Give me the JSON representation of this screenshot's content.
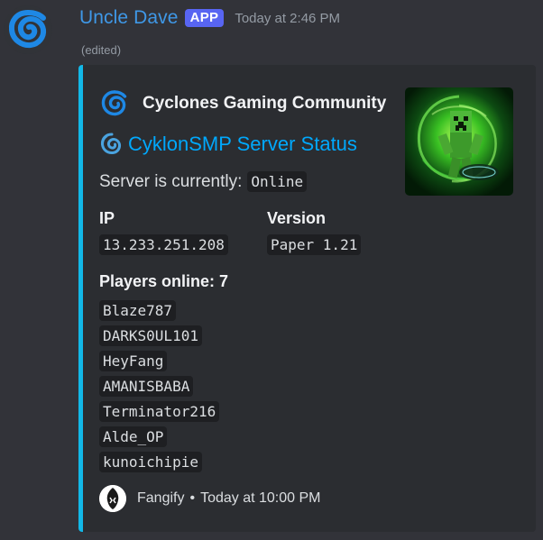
{
  "message": {
    "username": "Uncle Dave",
    "badge": "APP",
    "timestamp": "Today at 2:46 PM",
    "edited": "(edited)"
  },
  "embed": {
    "accent_color": "#12b8e8",
    "author": {
      "name": "Cyclones Gaming Community",
      "icon": "cyclone-icon"
    },
    "title": {
      "text": "CyklonSMP Server Status",
      "icon": "cyclone-icon"
    },
    "description": {
      "text": "Server is currently:",
      "status": "Online"
    },
    "fields": {
      "ip": {
        "name": "IP",
        "value": "13.233.251.208"
      },
      "version": {
        "name": "Version",
        "value": "Paper 1.21"
      }
    },
    "players": {
      "heading": "Players online: 7",
      "list": [
        "Blaze787",
        "DARKS0UL101",
        "HeyFang",
        "AMANISBABA",
        "Terminator216",
        "Alde_OP",
        "kunoichipie"
      ]
    },
    "footer": {
      "name": "Fangify",
      "separator": "•",
      "time": "Today at 10:00 PM",
      "icon": "fangify-icon"
    },
    "thumbnail": {
      "icon": "creeper-portal-image"
    }
  },
  "colors": {
    "background": "#323339",
    "embed_bg": "#2b2d31",
    "username": "#3f98e7",
    "badge": "#5865f2",
    "link": "#00a8fc"
  }
}
